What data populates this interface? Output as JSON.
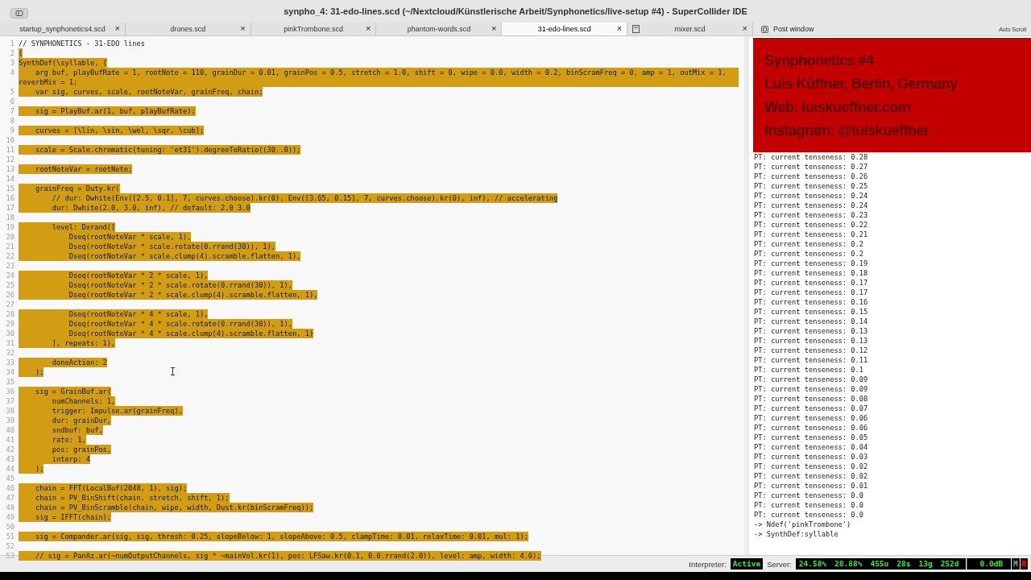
{
  "window": {
    "title": "synpho_4: 31-edo-lines.scd (~/Nextcloud/Künstlerische Arbeit/Synphonetics/live-setup #4) - SuperCollider IDE"
  },
  "editor_tabs": [
    {
      "label": "startup_synphonetics4.scd",
      "close": "×",
      "selected": false,
      "has_icon": false
    },
    {
      "label": "drones.scd",
      "close": "×",
      "selected": false,
      "has_icon": false
    },
    {
      "label": "pinkTrombone.scd",
      "close": "×",
      "selected": false,
      "has_icon": false
    },
    {
      "label": "phantom-words.scd",
      "close": "×",
      "selected": false,
      "has_icon": false
    },
    {
      "label": "31-edo-lines.scd",
      "close": "×",
      "selected": true,
      "has_icon": false
    },
    {
      "label": "mixer.scd",
      "close": "×",
      "selected": false,
      "has_icon": true
    }
  ],
  "code_lines": [
    {
      "number": "1",
      "text": "// SYNPHONETICS - 31-EDO lines",
      "selected": false
    },
    {
      "number": "2",
      "text": "(",
      "selected": true
    },
    {
      "number": "3",
      "text": "SynthDef(\\syllable, {",
      "selected": true
    },
    {
      "number": "4",
      "text": "    arg buf, playBufRate = 1, rootNote = 110, grainDur = 0.01, grainPos = 0.5, stretch = 1.0, shift = 0, wipe = 0.0, width = 0.2, binScramFreq = 0, amp = 1, outMix = 1, reverbMix = 1;",
      "selected": true
    },
    {
      "number": "5",
      "text": "    var sig, curves, scale, rootNoteVar, grainFreq, chain;",
      "selected": true
    },
    {
      "number": "6"
    },
    {
      "number": "7",
      "text": "    sig = PlayBuf.ar(1, buf, playBufRate);",
      "selected": true
    },
    {
      "number": "8"
    },
    {
      "number": "9",
      "text": "    curves = [\\lin, \\sin, \\wel, \\sqr, \\cub];",
      "selected": true
    },
    {
      "number": "10"
    },
    {
      "number": "11",
      "text": "    scale = Scale.chromatic(tuning: 'et31').degreeToRatio((30..0));",
      "selected": true
    },
    {
      "number": "12"
    },
    {
      "number": "13",
      "text": "    rootNoteVar = rootNote;",
      "selected": true
    },
    {
      "number": "14"
    },
    {
      "number": "15",
      "text": "    grainFreq = Duty.kr(",
      "selected": true
    },
    {
      "number": "16",
      "text": "        // dur: Dwhite(Env([2.5, 0.1], 7, curves.choose).kr(0), Env([3.65, 0.15], 7, curves.choose).kr(0), inf), // accelerating",
      "selected": true
    },
    {
      "number": "17",
      "text": "        dur: Dwhite(2.0, 3.0, inf), // default: 2.0 3.0",
      "selected": true
    },
    {
      "number": "18"
    },
    {
      "number": "19",
      "text": "        level: Dxrand([",
      "selected": true
    },
    {
      "number": "20",
      "text": "            Dseq(rootNoteVar * scale, 1),",
      "selected": true
    },
    {
      "number": "21",
      "text": "            Dseq(rootNoteVar * scale.rotate(0.rrand(30)), 1),",
      "selected": true
    },
    {
      "number": "22",
      "text": "            Dseq(rootNoteVar * scale.clump(4).scramble.flatten, 1),",
      "selected": true
    },
    {
      "number": "23"
    },
    {
      "number": "24",
      "text": "            Dseq(rootNoteVar * 2 * scale, 1),",
      "selected": true
    },
    {
      "number": "25",
      "text": "            Dseq(rootNoteVar * 2 * scale.rotate(0.rrand(30)), 1),",
      "selected": true
    },
    {
      "number": "26",
      "text": "            Dseq(rootNoteVar * 2 * scale.clump(4).scramble.flatten, 1),",
      "selected": true
    },
    {
      "number": "27"
    },
    {
      "number": "28",
      "text": "            Dseq(rootNoteVar * 4 * scale, 1),",
      "selected": true
    },
    {
      "number": "29",
      "text": "            Dseq(rootNoteVar * 4 * scale.rotate(0.rrand(30)), 1),",
      "selected": true
    },
    {
      "number": "30",
      "text": "            Dseq(rootNoteVar * 4 * scale.clump(4).scramble.flatten, 1)",
      "selected": true
    },
    {
      "number": "31",
      "text": "        ], repeats: 1),",
      "selected": true
    },
    {
      "number": "32"
    },
    {
      "number": "33",
      "text": "        doneAction: 2",
      "selected": true
    },
    {
      "number": "34",
      "text": "    );",
      "selected": true
    },
    {
      "number": "35"
    },
    {
      "number": "36",
      "text": "    sig = GrainBuf.ar(",
      "selected": true
    },
    {
      "number": "37",
      "text": "        numChannels: 1,",
      "selected": true
    },
    {
      "number": "38",
      "text": "        trigger: Impulse.ar(grainFreq),",
      "selected": true
    },
    {
      "number": "39",
      "text": "        dur: grainDur,",
      "selected": true
    },
    {
      "number": "40",
      "text": "        sndbuf: buf,",
      "selected": true
    },
    {
      "number": "41",
      "text": "        rate: 1,",
      "selected": true
    },
    {
      "number": "42",
      "text": "        pos: grainPos,",
      "selected": true
    },
    {
      "number": "43",
      "text": "        interp: 4",
      "selected": true
    },
    {
      "number": "44",
      "text": "    );",
      "selected": true
    },
    {
      "number": "45"
    },
    {
      "number": "46",
      "text": "    chain = FFT(LocalBuf(2048, 1), sig);",
      "selected": true
    },
    {
      "number": "47",
      "text": "    chain = PV_BinShift(chain, stretch, shift, 1);",
      "selected": true
    },
    {
      "number": "48",
      "text": "    chain = PV_BinScramble(chain, wipe, width, Dust.kr(binScramFreq));",
      "selected": true
    },
    {
      "number": "49",
      "text": "    sig = IFFT(chain);",
      "selected": true
    },
    {
      "number": "50"
    },
    {
      "number": "51",
      "text": "    sig = Compander.ar(sig, sig, thresh: 0.25, slopeBelow: 1, slopeAbove: 0.5, clampTime: 0.01, relaxTime: 0.01, mul: 1);",
      "selected": true
    },
    {
      "number": "52"
    },
    {
      "number": "53",
      "text": "    // sig = PanAz.ar(~numOutputChannels, sig * ~mainVol.kr(1), pos: LFSaw.kr(0.1, 0.0.rrand(2.0)), level: amp, width: 4.0);",
      "selected": true
    }
  ],
  "post_window": {
    "title": "Post window",
    "auto_scroll": "Auto Scroll",
    "overlay": [
      "Synphonetics #4",
      "Luis Küffner, Berlin, Germany",
      "Web: luiskueffner.com",
      "Instagram: @luiskueffner"
    ],
    "lines": [
      "PT: current tenseness: 0.28",
      "PT: current tenseness: 0.27",
      "PT: current tenseness: 0.26",
      "PT: current tenseness: 0.25",
      "PT: current tenseness: 0.24",
      "PT: current tenseness: 0.24",
      "PT: current tenseness: 0.23",
      "PT: current tenseness: 0.22",
      "PT: current tenseness: 0.21",
      "PT: current tenseness: 0.2",
      "PT: current tenseness: 0.2",
      "PT: current tenseness: 0.19",
      "PT: current tenseness: 0.18",
      "PT: current tenseness: 0.17",
      "PT: current tenseness: 0.17",
      "PT: current tenseness: 0.16",
      "PT: current tenseness: 0.15",
      "PT: current tenseness: 0.14",
      "PT: current tenseness: 0.13",
      "PT: current tenseness: 0.13",
      "PT: current tenseness: 0.12",
      "PT: current tenseness: 0.11",
      "PT: current tenseness: 0.1",
      "PT: current tenseness: 0.09",
      "PT: current tenseness: 0.09",
      "PT: current tenseness: 0.08",
      "PT: current tenseness: 0.07",
      "PT: current tenseness: 0.06",
      "PT: current tenseness: 0.06",
      "PT: current tenseness: 0.05",
      "PT: current tenseness: 0.04",
      "PT: current tenseness: 0.03",
      "PT: current tenseness: 0.02",
      "PT: current tenseness: 0.02",
      "PT: current tenseness: 0.01",
      "PT: current tenseness: 0.0",
      "PT: current tenseness: 0.0",
      "PT: current tenseness: 0.0",
      "-> Ndef('pinkTrombone')",
      "-> SynthDef:syllable"
    ]
  },
  "status_bar": {
    "interpreter_label": "Interpreter:",
    "interpreter_state": "Active",
    "server_label": "Server:",
    "server_stats": [
      "24.58%",
      "28.88%",
      "455u",
      "28s",
      "13g",
      "252d"
    ],
    "volume": "0.0dB",
    "mute": "M",
    "record": "R"
  }
}
